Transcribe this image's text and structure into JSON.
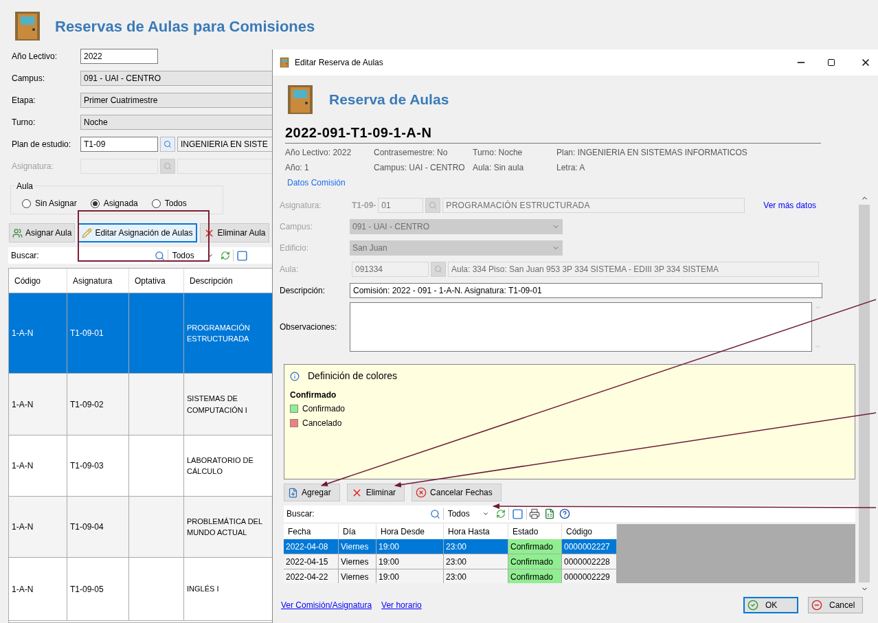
{
  "main_window": {
    "title": "Reservas de Aulas para Comisiones",
    "fields": [
      {
        "label": "Año Lectivo:",
        "kind": "text",
        "value": "2022",
        "disabled": false
      },
      {
        "label": "Campus:",
        "kind": "combo",
        "value": "091 - UAI - CENTRO",
        "disabled": false
      },
      {
        "label": "Etapa:",
        "kind": "combo",
        "value": "Primer Cuatrimestre",
        "disabled": false
      },
      {
        "label": "Turno:",
        "kind": "combo",
        "value": "Noche",
        "disabled": false
      },
      {
        "label": "Plan de estudio:",
        "kind": "lookup",
        "value": "T1-09",
        "description": "INGENIERIA EN SISTE",
        "disabled": false
      },
      {
        "label": "Asignatura:",
        "kind": "lookup",
        "disabled": true
      }
    ],
    "aula_group": {
      "label": "Aula",
      "options": [
        {
          "label": "Sin Asignar",
          "selected": false
        },
        {
          "label": "Asignada",
          "selected": true
        },
        {
          "label": "Todos",
          "selected": false
        }
      ]
    },
    "toolbar": [
      {
        "label": "Asignar Aula",
        "kind": "assign",
        "focused": false
      },
      {
        "label": "Editar Asignación de Aulas",
        "kind": "edit",
        "focused": true
      },
      {
        "label": "Eliminar Aula",
        "kind": "delete",
        "focused": false
      }
    ],
    "search": {
      "label": "Buscar:",
      "filter": "Todos"
    },
    "table": {
      "columns": [
        "Código",
        "Asignatura",
        "Optativa",
        "Descripción"
      ],
      "rows": [
        {
          "cells": [
            "1-A-N",
            "T1-09-01",
            "",
            "PROGRAMACIÓN ESTRUCTURADA"
          ],
          "selected": true
        },
        {
          "cells": [
            "1-A-N",
            "T1-09-02",
            "",
            "SISTEMAS DE COMPUTACIÓN I"
          ],
          "selected": false
        },
        {
          "cells": [
            "1-A-N",
            "T1-09-03",
            "",
            "LABORATORIO DE CÁLCULO"
          ],
          "selected": false
        },
        {
          "cells": [
            "1-A-N",
            "T1-09-04",
            "",
            "PROBLEMÁTICA DEL MUNDO ACTUAL"
          ],
          "selected": false
        },
        {
          "cells": [
            "1-A-N",
            "T1-09-05",
            "",
            "INGLÉS I"
          ],
          "selected": false
        }
      ]
    }
  },
  "dialog": {
    "title": "Editar Reserva de Aulas",
    "header": "Reserva de Aulas",
    "code": "2022-091-T1-09-1-A-N",
    "info_rows": [
      [
        "Año Lectivo: 2022",
        "Contrasemestre: No",
        "Turno: Noche",
        "Plan: INGENIERIA EN SISTEMAS INFORMATICOS"
      ],
      [
        "Año: 1",
        "Campus: UAI - CENTRO",
        "Aula: Sin aula",
        "Letra: A"
      ]
    ],
    "datos_link": "Datos Comisión",
    "fields": [
      {
        "label": "Asignatura:",
        "kind": "asignatura",
        "prefix": "T1-09-",
        "value": "01",
        "description": "PROGRAMACIÓN ESTRUCTURADA",
        "link": "Ver más datos",
        "disabled": true
      },
      {
        "label": "Campus:",
        "kind": "combo",
        "value": "091 - UAI - CENTRO",
        "disabled": true
      },
      {
        "label": "Edificio:",
        "kind": "combo",
        "value": "San Juan",
        "disabled": true
      },
      {
        "label": "Aula:",
        "kind": "lookup",
        "value": "091334",
        "description": "Aula: 334 Piso: San Juan 953 3P 334 SISTEMA - EDIII 3P 334 SISTEMA",
        "disabled": true
      },
      {
        "label": "Descripción:",
        "kind": "text",
        "value": "Comisión: 2022  -  091  -  1-A-N. Asignatura: T1-09-01",
        "disabled": false
      },
      {
        "label": "Observaciones:",
        "kind": "textarea",
        "disabled": false
      }
    ],
    "legend": {
      "title": "Definición de colores",
      "group": "Confirmado",
      "items": [
        {
          "label": "Confirmado",
          "color": "#90ee90"
        },
        {
          "label": "Cancelado",
          "color": "#f08080"
        }
      ]
    },
    "buttons": [
      {
        "label": "Agregar",
        "kind": "add"
      },
      {
        "label": "Eliminar",
        "kind": "delete"
      },
      {
        "label": "Cancelar Fechas",
        "kind": "cancel"
      }
    ],
    "search": {
      "label": "Buscar:",
      "filter": "Todos"
    },
    "grid": {
      "columns": [
        "Fecha",
        "Día",
        "Hora Desde",
        "Hora Hasta",
        "Estado",
        "Código"
      ],
      "rows": [
        {
          "cells": [
            "2022-04-08",
            "Viernes",
            "19:00",
            "23:00",
            "Confirmado",
            "0000002227"
          ],
          "selected": true,
          "color": "#90ee90"
        },
        {
          "cells": [
            "2022-04-15",
            "Viernes",
            "19:00",
            "23:00",
            "Confirmado",
            "0000002228"
          ],
          "selected": false,
          "color": "#90ee90"
        },
        {
          "cells": [
            "2022-04-22",
            "Viernes",
            "19:00",
            "23:00",
            "Confirmado",
            "0000002229"
          ],
          "selected": false,
          "color": "#90ee90"
        }
      ]
    },
    "footer_links": [
      "Ver Comisión/Asignatura",
      "Ver horario"
    ],
    "footer_buttons": [
      {
        "label": "OK",
        "kind": "ok"
      },
      {
        "label": "Cancel",
        "kind": "cancel"
      }
    ]
  }
}
